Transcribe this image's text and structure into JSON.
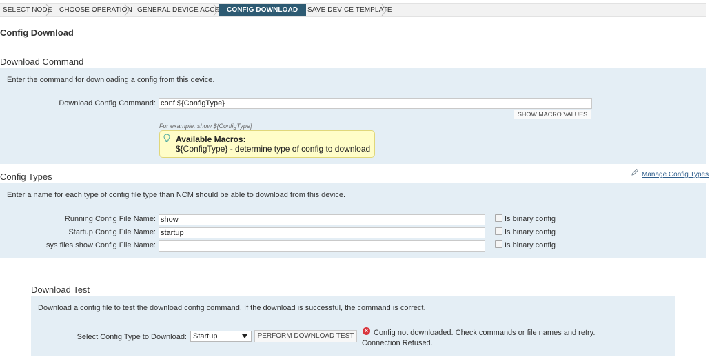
{
  "breadcrumb": {
    "steps": [
      "SELECT NODE",
      "CHOOSE OPERATION",
      "GENERAL DEVICE ACCESS",
      "CONFIG DOWNLOAD",
      "SAVE DEVICE TEMPLATE"
    ],
    "active_index": 3
  },
  "page_title": "Config Download",
  "download_command": {
    "title": "Download Command",
    "description": "Enter the command for downloading a config from this device.",
    "field_label": "Download Config Command:",
    "field_value": "conf ${ConfigType}",
    "macro_button": "SHOW MACRO VALUES",
    "example": "For example: show ${ConfigType}",
    "macros_title": "Available Macros:",
    "macros_text": "${ConfigType} - determine type of config to download"
  },
  "config_types": {
    "title": "Config Types",
    "manage_link": "Manage Config Types",
    "description": "Enter a name for each type of config file type than NCM should be able to download from this device.",
    "rows": [
      {
        "label": "Running Config File Name:",
        "value": "show",
        "checkbox_label": "Is binary config"
      },
      {
        "label": "Startup Config File Name:",
        "value": "startup",
        "checkbox_label": "Is binary config"
      },
      {
        "label": "sys files show Config File Name:",
        "value": "",
        "checkbox_label": "Is binary config"
      }
    ]
  },
  "download_test": {
    "title": "Download Test",
    "description": "Download a config file to test the download config command. If the download is successful, the command is correct.",
    "select_label": "Select Config Type to Download:",
    "select_value": "Startup",
    "button": "PERFORM DOWNLOAD TEST",
    "error_line1": "Config not downloaded. Check commands or file names and retry.",
    "error_line2": "Connection Refused."
  },
  "colors": {
    "panel": "#e4eef5",
    "active_crumb": "#2d5a72",
    "error": "#d9363e",
    "link": "#2f5e8c"
  }
}
